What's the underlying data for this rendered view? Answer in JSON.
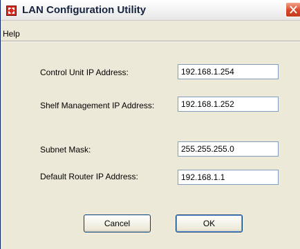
{
  "window": {
    "title": "LAN Configuration Utility",
    "icon": "app-icon",
    "close_icon": "close-icon"
  },
  "menu": {
    "items": [
      {
        "label": "Help"
      }
    ]
  },
  "form": {
    "control_unit": {
      "label": "Control Unit IP Address:",
      "value": "192.168.1.254"
    },
    "shelf_management": {
      "label": "Shelf Management IP Address:",
      "value": "192.168.1.252"
    },
    "subnet_mask": {
      "label": "Subnet Mask:",
      "value": "255.255.255.0"
    },
    "default_router": {
      "label": "Default Router IP Address:",
      "value": "192.168.1.1"
    }
  },
  "buttons": {
    "cancel": "Cancel",
    "ok": "OK"
  },
  "colors": {
    "window_bg": "#ece9d8",
    "close_button": "#d9462a",
    "field_border": "#7f9db9",
    "button_border": "#003c74"
  }
}
